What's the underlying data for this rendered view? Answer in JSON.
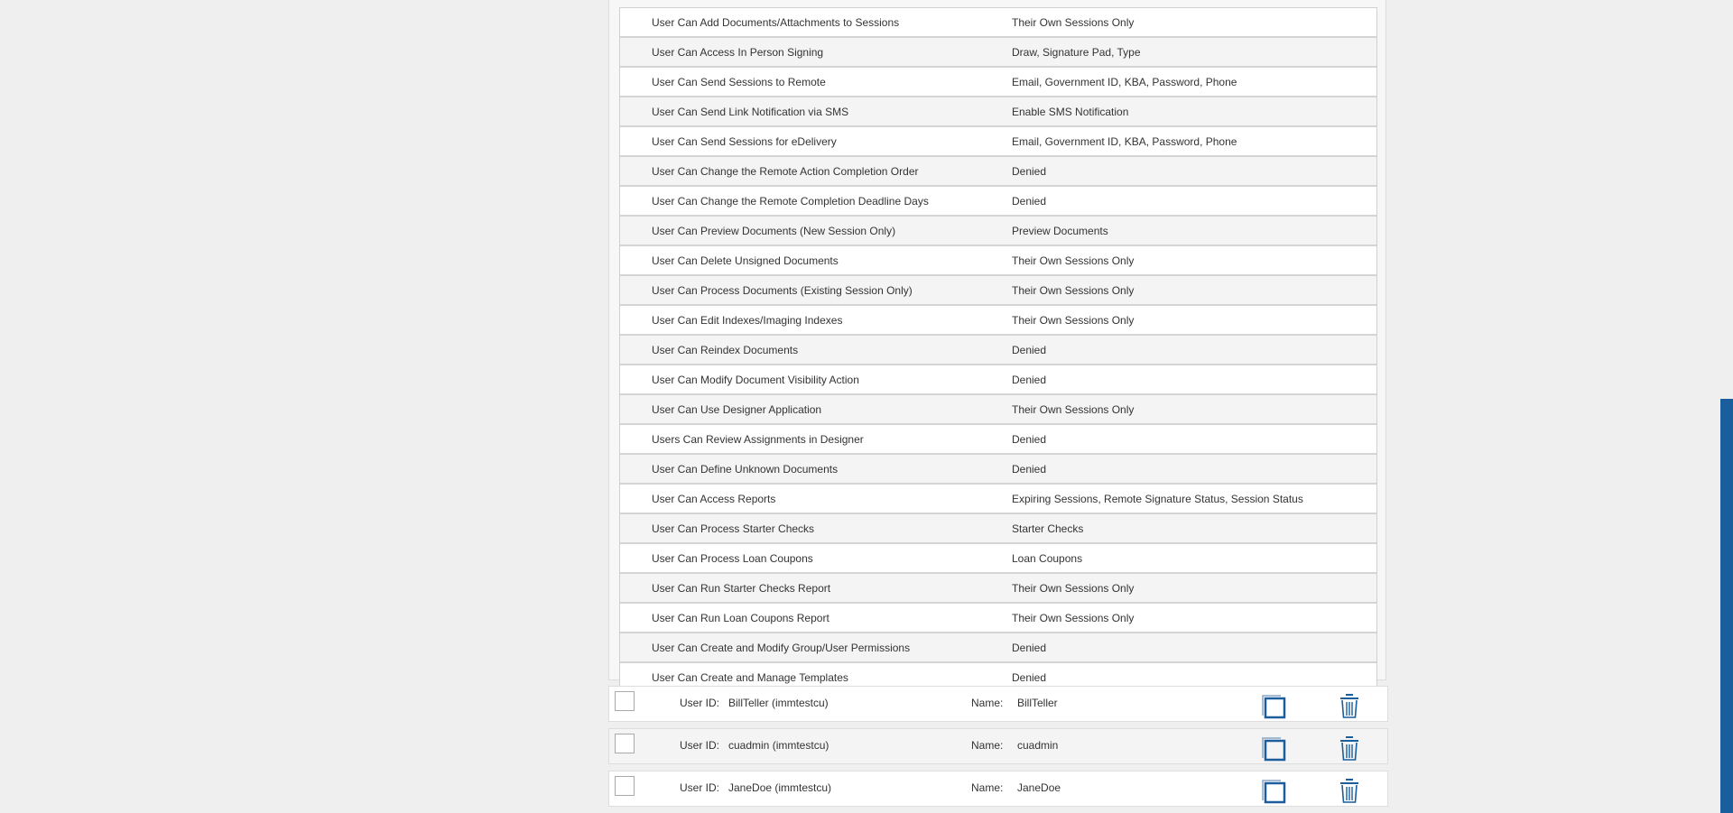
{
  "permissions": [
    {
      "name": "User Can Add Documents/Attachments to Sessions",
      "value": "Their Own Sessions Only"
    },
    {
      "name": "User Can Access In Person Signing",
      "value": "Draw, Signature Pad, Type"
    },
    {
      "name": "User Can Send Sessions to Remote",
      "value": "Email, Government ID, KBA, Password, Phone"
    },
    {
      "name": "User Can Send Link Notification via SMS",
      "value": "Enable SMS Notification"
    },
    {
      "name": "User Can Send Sessions for eDelivery",
      "value": "Email, Government ID, KBA, Password, Phone"
    },
    {
      "name": "User Can Change the Remote Action Completion Order",
      "value": "Denied"
    },
    {
      "name": "User Can Change the Remote Completion Deadline Days",
      "value": "Denied"
    },
    {
      "name": "User Can Preview Documents (New Session Only)",
      "value": "Preview Documents"
    },
    {
      "name": "User Can Delete Unsigned Documents",
      "value": "Their Own Sessions Only"
    },
    {
      "name": "User Can Process Documents (Existing Session Only)",
      "value": "Their Own Sessions Only"
    },
    {
      "name": "User Can Edit Indexes/Imaging Indexes",
      "value": "Their Own Sessions Only"
    },
    {
      "name": "User Can Reindex Documents",
      "value": "Denied"
    },
    {
      "name": "User Can Modify Document Visibility Action",
      "value": "Denied"
    },
    {
      "name": "User Can Use Designer Application",
      "value": "Their Own Sessions Only"
    },
    {
      "name": "Users Can Review Assignments in Designer",
      "value": "Denied"
    },
    {
      "name": "User Can Define Unknown Documents",
      "value": "Denied"
    },
    {
      "name": "User Can Access Reports",
      "value": "Expiring Sessions, Remote Signature Status, Session Status"
    },
    {
      "name": "User Can Process Starter Checks",
      "value": "Starter Checks"
    },
    {
      "name": "User Can Process Loan Coupons",
      "value": "Loan Coupons"
    },
    {
      "name": "User Can Run Starter Checks Report",
      "value": "Their Own Sessions Only"
    },
    {
      "name": "User Can Run Loan Coupons Report",
      "value": "Their Own Sessions Only"
    },
    {
      "name": "User Can Create and Modify Group/User Permissions",
      "value": "Denied"
    },
    {
      "name": "User Can Create and Manage Templates",
      "value": "Denied"
    }
  ],
  "users": [
    {
      "user_id_label": "User ID:",
      "user_id": "BillTeller (immtestcu)",
      "name_label": "Name:",
      "name": "BillTeller"
    },
    {
      "user_id_label": "User ID:",
      "user_id": "cuadmin (immtestcu)",
      "name_label": "Name:",
      "name": "cuadmin"
    },
    {
      "user_id_label": "User ID:",
      "user_id": "JaneDoe (immtestcu)",
      "name_label": "Name:",
      "name": "JaneDoe"
    }
  ],
  "colors": {
    "accent": "#1a5e9e",
    "background": "#efefef"
  },
  "icons": {
    "copy": "copy-icon",
    "delete": "trash-icon"
  }
}
